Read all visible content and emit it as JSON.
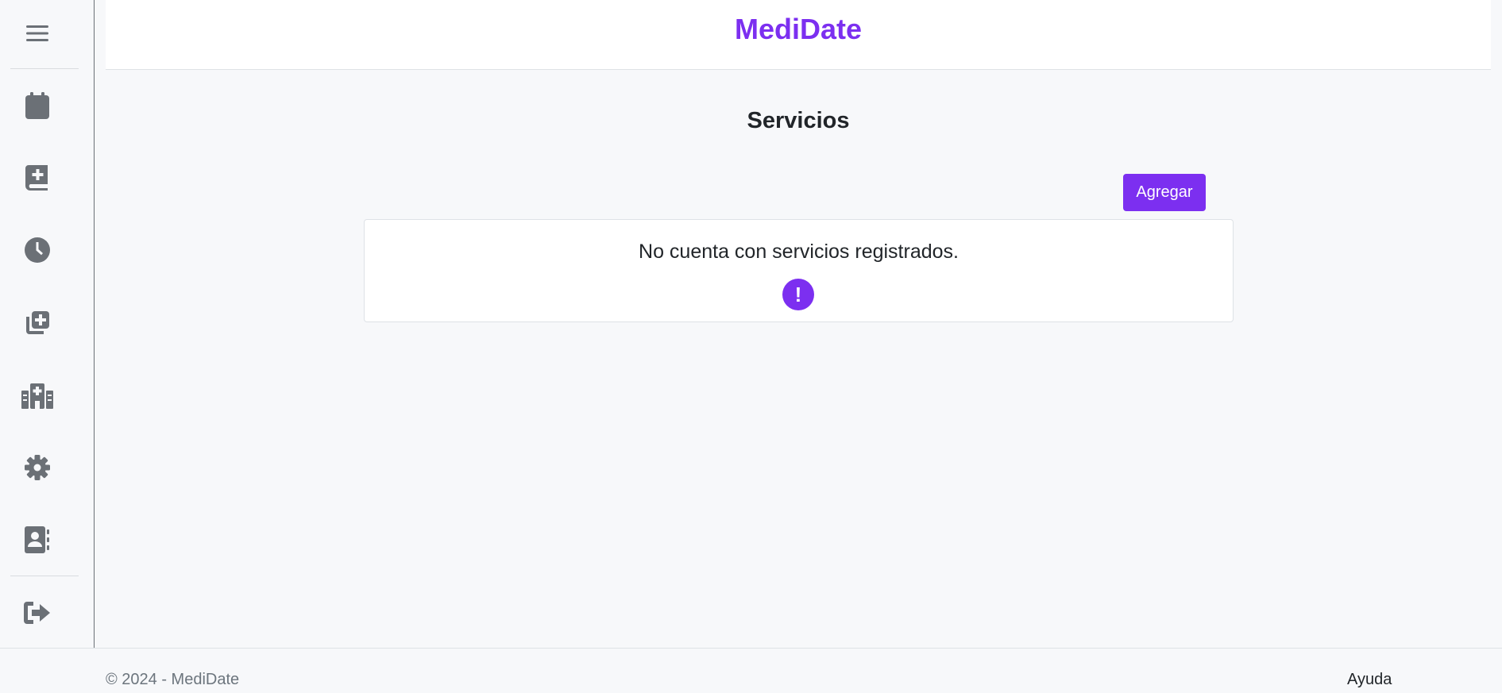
{
  "header": {
    "brand": "MediDate"
  },
  "sidebar": {
    "items": [
      {
        "icon": "menu-icon"
      },
      {
        "icon": "calendar-icon"
      },
      {
        "icon": "medical-book-icon"
      },
      {
        "icon": "clock-icon"
      },
      {
        "icon": "add-service-icon"
      },
      {
        "icon": "hospital-icon"
      },
      {
        "icon": "gear-icon"
      },
      {
        "icon": "contact-book-icon"
      },
      {
        "icon": "logout-icon"
      }
    ]
  },
  "main": {
    "title": "Servicios",
    "add_label": "Agregar",
    "empty_message": "No cuenta con servicios registrados.",
    "alert_glyph": "!"
  },
  "footer": {
    "copyright": "© 2024 - MediDate",
    "help_label": "Ayuda"
  },
  "colors": {
    "accent": "#7c2ff0",
    "icon": "#6b7076",
    "background": "#f7f8fa"
  }
}
